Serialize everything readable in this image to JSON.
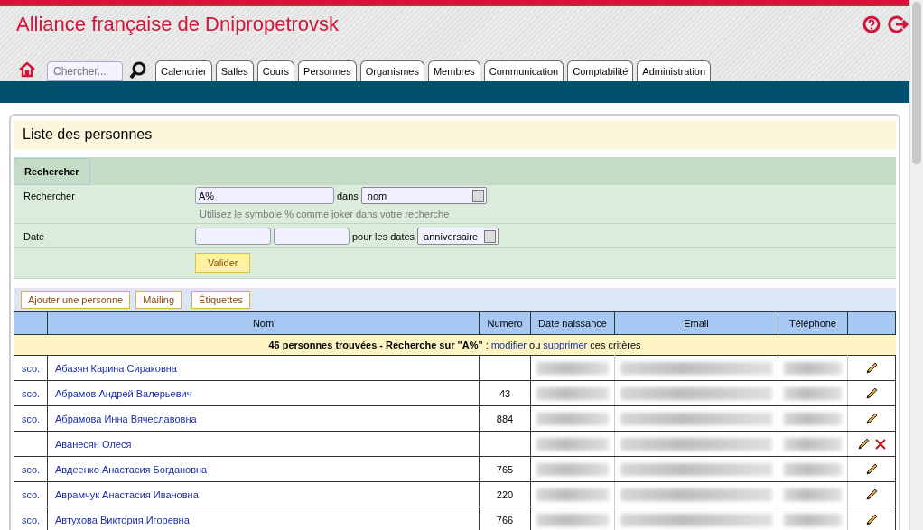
{
  "header": {
    "title": "Alliance française de Dnipropetrovsk",
    "search": {
      "placeholder": "Chercher..."
    }
  },
  "nav_tabs": [
    {
      "label": "Calendrier"
    },
    {
      "label": "Salles"
    },
    {
      "label": "Cours"
    },
    {
      "label": "Personnes"
    },
    {
      "label": "Organismes"
    },
    {
      "label": "Membres"
    },
    {
      "label": "Communication"
    },
    {
      "label": "Comptabilité"
    },
    {
      "label": "Administration"
    }
  ],
  "page_title": "Liste des personnes",
  "search_panel": {
    "tab": "Rechercher",
    "query_label": "Rechercher",
    "query_value": "A%",
    "in_label": "dans",
    "in_value": "nom",
    "hint": "Utilisez le symbole % comme joker dans votre recherche",
    "date_label": "Date",
    "dates_label": "pour les dates",
    "dates_value": "anniversaire",
    "submit": "Valider"
  },
  "actions": [
    "Ajouter une personne",
    "Mailing",
    "Étiquettes"
  ],
  "table": {
    "columns": [
      "Nom",
      "Numero",
      "Date naissance",
      "Email",
      "Téléphone"
    ],
    "summary": {
      "count": "46 personnes trouvées - Recherche sur \"A%\"",
      "sep": ":",
      "modify": "modifier",
      "or": "ou",
      "delete": "supprimer",
      "tail": "ces critères"
    },
    "rows": [
      {
        "flag": "sco.",
        "name": "Абазян Карина Сираковна",
        "numero": "",
        "deletable": false
      },
      {
        "flag": "sco.",
        "name": "Абрамов Андрей Валерьевич",
        "numero": "43",
        "deletable": false
      },
      {
        "flag": "sco.",
        "name": "Абрамова Инна Вячеславовна",
        "numero": "884",
        "deletable": false
      },
      {
        "flag": "",
        "name": "Аванесян Олеся",
        "numero": "",
        "deletable": true
      },
      {
        "flag": "sco.",
        "name": "Авдеенко Анастасия Богдановна",
        "numero": "765",
        "deletable": false
      },
      {
        "flag": "sco.",
        "name": "Аврамчук Анастасия Ивановна",
        "numero": "220",
        "deletable": false
      },
      {
        "flag": "sco.",
        "name": "Автухова Виктория Игоревна",
        "numero": "766",
        "deletable": false
      }
    ]
  }
}
